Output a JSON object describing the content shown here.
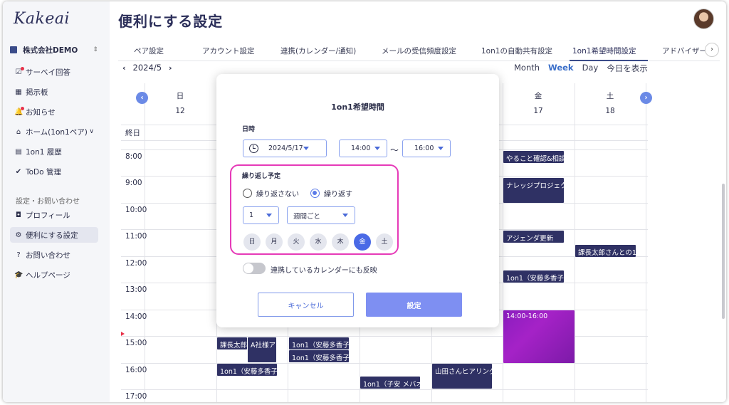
{
  "app": {
    "logo": "Kakeai",
    "page_title": "便利にする設定"
  },
  "sidebar": {
    "company": "株式会社DEMO",
    "items": [
      {
        "label": "サーベイ回答",
        "icon": "survey-icon",
        "badge": true
      },
      {
        "label": "掲示板",
        "icon": "board-icon",
        "badge": false
      },
      {
        "label": "お知らせ",
        "icon": "bell-icon",
        "badge": true
      },
      {
        "label": "ホーム(1on1ペア)",
        "icon": "home-icon",
        "badge": false
      },
      {
        "label": "1on1 履歴",
        "icon": "history-icon",
        "badge": false
      },
      {
        "label": "ToDo 管理",
        "icon": "check-icon",
        "badge": false
      }
    ],
    "section_label": "設定・お問い合わせ",
    "settings_items": [
      {
        "label": "プロフィール",
        "icon": "profile-icon"
      },
      {
        "label": "便利にする設定",
        "icon": "gear-icon",
        "active": true
      },
      {
        "label": "お問い合わせ",
        "icon": "question-icon"
      },
      {
        "label": "ヘルプページ",
        "icon": "help-icon"
      }
    ]
  },
  "tabs": [
    "ペア設定",
    "アカウント設定",
    "連携(カレンダー/通知)",
    "メールの受信頻度設定",
    "1on1の自動共有設定",
    "1on1希望時間設定",
    "アドバイザー"
  ],
  "active_tab": "1on1希望時間設定",
  "calendar": {
    "month": "2024/5",
    "views": [
      "Month",
      "Week",
      "Day",
      "今日を表示"
    ],
    "active_view": "Week",
    "days": [
      {
        "name": "日",
        "num": "12"
      },
      {
        "name": "金",
        "num": "17"
      },
      {
        "name": "土",
        "num": "18"
      }
    ],
    "allday_label": "終日",
    "hours": [
      "8:00",
      "9:00",
      "10:00",
      "11:00",
      "12:00",
      "13:00",
      "14:00",
      "15:00",
      "16:00",
      "17:00"
    ],
    "events": [
      "やること確認&相談",
      "ナレッジプロジェク",
      "アジェンダ更新",
      "課長太郎さんとの1o",
      "1on1（安藤多香子さ",
      "14:00-16:00",
      "課長太郎",
      "A社様ア",
      "1on1（安藤多香子さ",
      "1on1（安藤多香子さ",
      "1on1（安藤多香子さ",
      "山田さんヒアリング",
      "1on1（子安 メバオさ"
    ]
  },
  "modal": {
    "title": "1on1希望時間",
    "datetime_label": "日時",
    "date": "2024/5/17",
    "start_time": "14:00",
    "end_time": "16:00",
    "tilde": "〜",
    "repeat_label": "繰り返し予定",
    "radio_no_repeat": "繰り返さない",
    "radio_repeat": "繰り返す",
    "interval": "1",
    "frequency": "週間ごと",
    "weekdays": [
      "日",
      "月",
      "火",
      "水",
      "木",
      "金",
      "土"
    ],
    "selected_weekday": "金",
    "sync_label": "連携しているカレンダーにも反映",
    "cancel": "キャンセル",
    "ok": "設定"
  },
  "colors": {
    "accent": "#4a6ae6",
    "event": "#2f3164",
    "highlight": "#e63ab8",
    "purple_event": "#9420c2"
  }
}
